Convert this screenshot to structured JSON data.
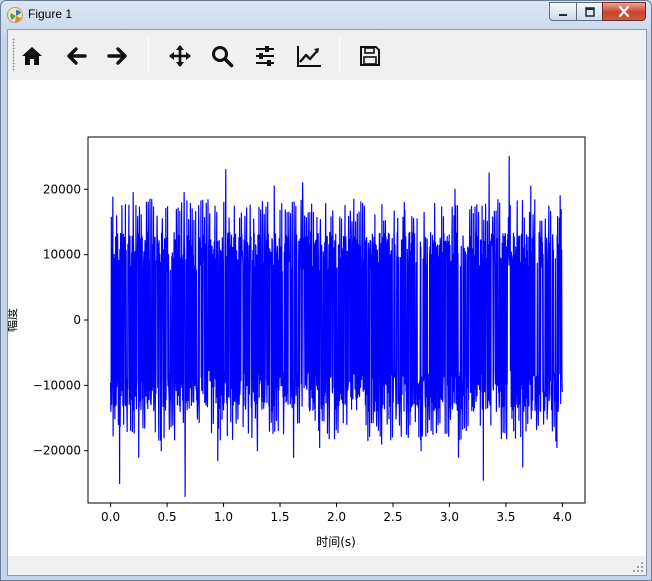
{
  "window": {
    "title": "Figure 1"
  },
  "toolbar": {
    "buttons": [
      {
        "name": "home",
        "icon": "home-icon"
      },
      {
        "name": "back",
        "icon": "arrow-left-icon"
      },
      {
        "name": "forward",
        "icon": "arrow-right-icon"
      },
      {
        "name": "pan",
        "icon": "move-icon"
      },
      {
        "name": "zoom",
        "icon": "magnifier-icon"
      },
      {
        "name": "subplots",
        "icon": "sliders-icon"
      },
      {
        "name": "edit-axes",
        "icon": "line-chart-icon"
      },
      {
        "name": "save",
        "icon": "floppy-disk-icon"
      }
    ]
  },
  "chart_data": {
    "type": "line",
    "title": "",
    "xlabel": "时间(s)",
    "ylabel": "幅度",
    "xlim": [
      -0.2,
      4.2
    ],
    "ylim": [
      -28000,
      28000
    ],
    "xticks": [
      0.0,
      0.5,
      1.0,
      1.5,
      2.0,
      2.5,
      3.0,
      3.5,
      4.0
    ],
    "xtick_labels": [
      "0.0",
      "0.5",
      "1.0",
      "1.5",
      "2.0",
      "2.5",
      "3.0",
      "3.5",
      "4.0"
    ],
    "yticks": [
      -20000,
      -10000,
      0,
      10000,
      20000
    ],
    "ytick_labels": [
      "−20000",
      "−10000",
      "0",
      "10000",
      "20000"
    ],
    "series": [
      {
        "color": "#0000ff",
        "x_range": [
          0,
          4.0
        ],
        "typical_band": [
          -14000,
          13500
        ],
        "peaks": [
          {
            "x": 0.02,
            "y": 18800
          },
          {
            "x": 0.1,
            "y": 17500
          },
          {
            "x": 0.2,
            "y": 19500
          },
          {
            "x": 0.35,
            "y": 18500
          },
          {
            "x": 0.65,
            "y": 19500
          },
          {
            "x": 0.78,
            "y": 17500
          },
          {
            "x": 1.02,
            "y": 23000
          },
          {
            "x": 1.45,
            "y": 20500
          },
          {
            "x": 1.7,
            "y": 21000
          },
          {
            "x": 2.2,
            "y": 16500
          },
          {
            "x": 2.6,
            "y": 18000
          },
          {
            "x": 3.05,
            "y": 20000
          },
          {
            "x": 3.35,
            "y": 22500
          },
          {
            "x": 3.53,
            "y": 25000
          },
          {
            "x": 3.72,
            "y": 20500
          },
          {
            "x": 3.98,
            "y": 19000
          }
        ],
        "troughs": [
          {
            "x": 0.08,
            "y": -25000
          },
          {
            "x": 0.25,
            "y": -21000
          },
          {
            "x": 0.45,
            "y": -20000
          },
          {
            "x": 0.66,
            "y": -27000
          },
          {
            "x": 0.95,
            "y": -21500
          },
          {
            "x": 1.3,
            "y": -20000
          },
          {
            "x": 1.62,
            "y": -21000
          },
          {
            "x": 1.85,
            "y": -19500
          },
          {
            "x": 2.4,
            "y": -19000
          },
          {
            "x": 2.75,
            "y": -20000
          },
          {
            "x": 3.08,
            "y": -21000
          },
          {
            "x": 3.3,
            "y": -24500
          },
          {
            "x": 3.65,
            "y": -22500
          },
          {
            "x": 3.95,
            "y": -19500
          }
        ]
      }
    ]
  }
}
